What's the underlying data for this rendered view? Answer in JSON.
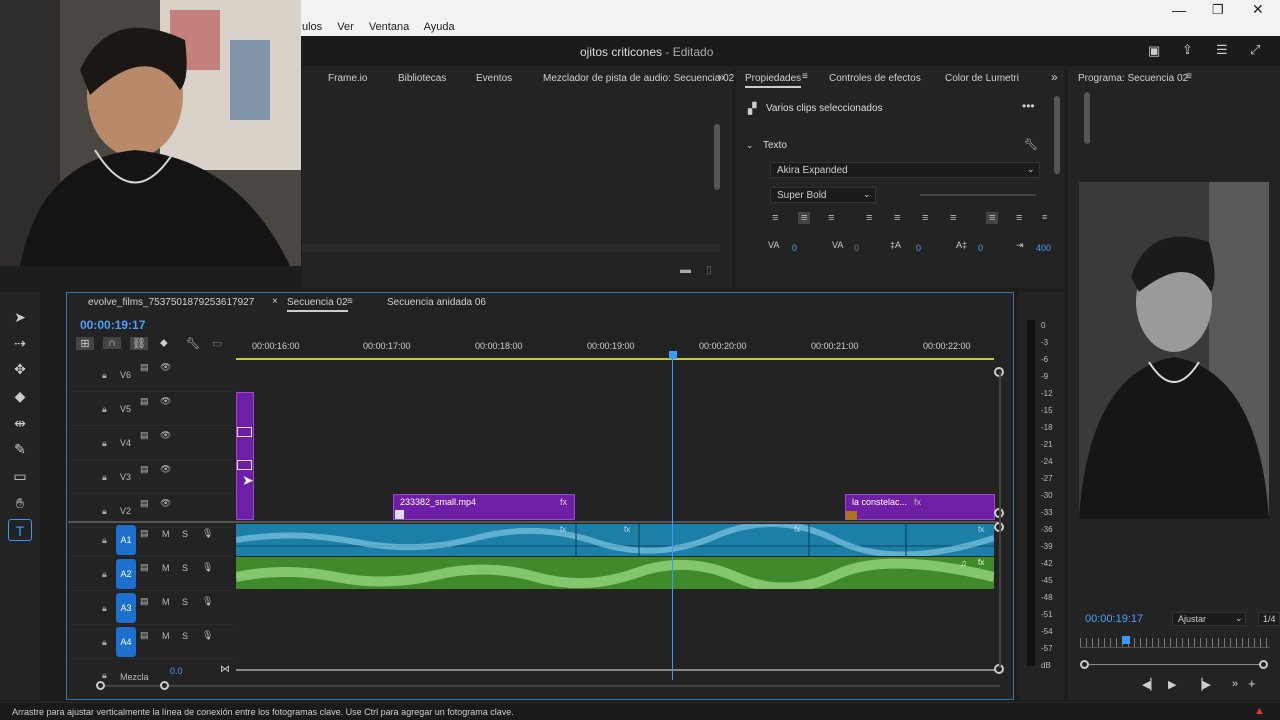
{
  "menu": {
    "items": [
      "ulos",
      "Ver",
      "Ventana",
      "Ayuda"
    ]
  },
  "window": {
    "title": "ojitos criticones",
    "title_suffix": " - Editado"
  },
  "top_panel": {
    "tabs": [
      "Frame.io",
      "Bibliotecas",
      "Eventos",
      "Mezclador de pista de audio: Secuencia 02"
    ]
  },
  "properties": {
    "tabs": [
      "Propiedades",
      "Controles de efectos",
      "Color de Lumetri"
    ],
    "selection": "Varios clips seleccionados",
    "section": "Texto",
    "font": "Akira Expanded",
    "weight": "Super Bold",
    "kerning": "0",
    "tracking": "0",
    "leading": "0",
    "baseline": "0",
    "tsume": "400"
  },
  "timeline": {
    "tabs": [
      "evolve_films_7537501879253617927",
      "Secuencia 02",
      "Secuencia anidada 06"
    ],
    "timecode": "00:00:19:17",
    "ruler": [
      "00:00:16:00",
      "00:00:17:00",
      "00:00:18:00",
      "00:00:19:00",
      "00:00:20:00",
      "00:00:21:00",
      "00:00:22:00"
    ],
    "video_tracks": [
      "V6",
      "V5",
      "V4",
      "V3",
      "V2"
    ],
    "audio_tracks": [
      "A1",
      "A2",
      "A3",
      "A4"
    ],
    "mix_label": "Mezcla",
    "mix_value": "0.0",
    "clip1": "233382_small.mp4",
    "clip2": "la constelac...",
    "fx": "fx",
    "m": "M",
    "s": "S"
  },
  "meter": {
    "db_labels": [
      "0",
      "-3",
      "-6",
      "-9",
      "-12",
      "-15",
      "-18",
      "-21",
      "-24",
      "-27",
      "-30",
      "-33",
      "-36",
      "-39",
      "-42",
      "-45",
      "-48",
      "-51",
      "-54",
      "-57",
      "dB"
    ]
  },
  "program": {
    "title": "Programa: Secuencia 02",
    "timecode": "00:00:19:17",
    "fit": "Ajustar",
    "resolution": "1/4"
  },
  "status": {
    "text": "Arrastre para ajustar verticalmente la línea de conexión entre los fotogramas clave. Use Ctrl para agregar un fotograma clave."
  },
  "colors": {
    "accent": "#4aa0ff",
    "video_clip": "#6f1fa6",
    "audio_a1": "#1c7fa8",
    "audio_a2": "#3f8a2b",
    "track_blue": "#1d6fd0"
  }
}
